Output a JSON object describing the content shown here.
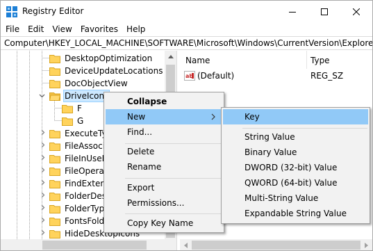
{
  "window": {
    "title": "Registry Editor",
    "accent": "#0078d7"
  },
  "menubar": [
    "File",
    "Edit",
    "View",
    "Favorites",
    "Help"
  ],
  "address": "Computer\\HKEY_LOCAL_MACHINE\\SOFTWARE\\Microsoft\\Windows\\CurrentVersion\\Explorer\\Drive",
  "tree": {
    "items": [
      {
        "label": "DesktopOptimization",
        "icon": "folder-icon"
      },
      {
        "label": "DeviceUpdateLocations",
        "icon": "folder-icon"
      },
      {
        "label": "DocObjectView",
        "icon": "folder-icon"
      },
      {
        "label": "DriveIcons",
        "icon": "folder-open-icon",
        "selected": true
      },
      {
        "label": "F",
        "icon": "folder-icon"
      },
      {
        "label": "G",
        "icon": "folder-icon"
      },
      {
        "label": "ExecuteTyp",
        "icon": "folder-icon"
      },
      {
        "label": "FileAssocia",
        "icon": "folder-icon"
      },
      {
        "label": "FileInUseRe",
        "icon": "folder-icon"
      },
      {
        "label": "FileOperati",
        "icon": "folder-icon"
      },
      {
        "label": "FindExtens",
        "icon": "folder-icon"
      },
      {
        "label": "FolderDesc",
        "icon": "folder-icon"
      },
      {
        "label": "FolderType",
        "icon": "folder-icon"
      },
      {
        "label": "FontsFolde",
        "icon": "folder-icon"
      },
      {
        "label": "HideDesktopIcons",
        "icon": "folder-icon"
      }
    ]
  },
  "list": {
    "columns": [
      "Name",
      "Type"
    ],
    "rows": [
      {
        "name": "(Default)",
        "type": "REG_SZ",
        "icon": "string-value-icon"
      }
    ]
  },
  "context_menu": {
    "items": [
      "Collapse",
      "New",
      "Find...",
      "Delete",
      "Rename",
      "Export",
      "Permissions...",
      "Copy Key Name"
    ],
    "bold_item": "Collapse",
    "highlighted_item": "New"
  },
  "new_submenu": {
    "items": [
      "Key",
      "String Value",
      "Binary Value",
      "DWORD (32-bit) Value",
      "QWORD (64-bit) Value",
      "Multi-String Value",
      "Expandable String Value"
    ],
    "highlighted_item": "Key",
    "highlight_color": "#91c9f7"
  }
}
